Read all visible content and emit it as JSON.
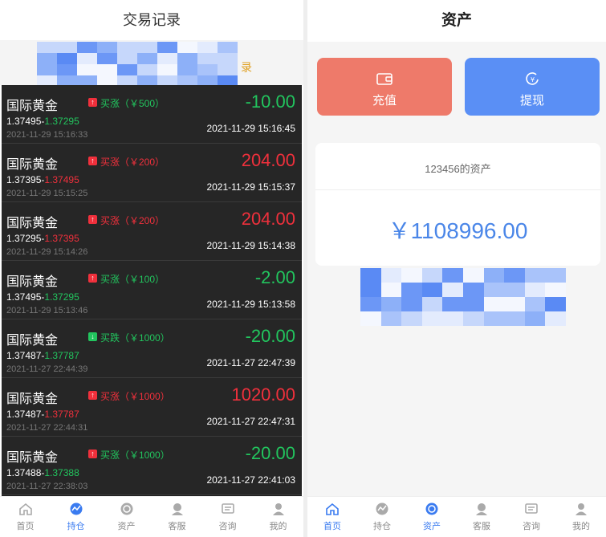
{
  "left": {
    "title": "交易记录",
    "subtab_right": "录",
    "trades": [
      {
        "name": "国际黄金",
        "direction": "up",
        "dir_label": "买涨（￥500）",
        "dir_color": "green",
        "profit": "-10.00",
        "profit_color": "green",
        "open_price": "1.37495-",
        "close_price": "1.37295",
        "close_color": "green",
        "open_time": "2021-11-29 15:16:33",
        "close_time": "2021-11-29 15:16:45"
      },
      {
        "name": "国际黄金",
        "direction": "up",
        "dir_label": "买涨（￥200）",
        "dir_color": "red",
        "profit": "204.00",
        "profit_color": "red",
        "open_price": "1.37395-",
        "close_price": "1.37495",
        "close_color": "red",
        "open_time": "2021-11-29 15:15:25",
        "close_time": "2021-11-29 15:15:37"
      },
      {
        "name": "国际黄金",
        "direction": "up",
        "dir_label": "买涨（￥200）",
        "dir_color": "red",
        "profit": "204.00",
        "profit_color": "red",
        "open_price": "1.37295-",
        "close_price": "1.37395",
        "close_color": "red",
        "open_time": "2021-11-29 15:14:26",
        "close_time": "2021-11-29 15:14:38"
      },
      {
        "name": "国际黄金",
        "direction": "up",
        "dir_label": "买涨（￥100）",
        "dir_color": "green",
        "profit": "-2.00",
        "profit_color": "green",
        "open_price": "1.37495-",
        "close_price": "1.37295",
        "close_color": "green",
        "open_time": "2021-11-29 15:13:46",
        "close_time": "2021-11-29 15:13:58"
      },
      {
        "name": "国际黄金",
        "direction": "down",
        "dir_label": "买跌（￥1000）",
        "dir_color": "green",
        "profit": "-20.00",
        "profit_color": "green",
        "open_price": "1.37487-",
        "close_price": "1.37787",
        "close_color": "green",
        "open_time": "2021-11-27 22:44:39",
        "close_time": "2021-11-27 22:47:39"
      },
      {
        "name": "国际黄金",
        "direction": "up",
        "dir_label": "买涨（￥1000）",
        "dir_color": "red",
        "profit": "1020.00",
        "profit_color": "red",
        "open_price": "1.37487-",
        "close_price": "1.37787",
        "close_color": "red",
        "open_time": "2021-11-27 22:44:31",
        "close_time": "2021-11-27 22:47:31"
      },
      {
        "name": "国际黄金",
        "direction": "up",
        "dir_label": "买涨（￥1000）",
        "dir_color": "green",
        "profit": "-20.00",
        "profit_color": "green",
        "open_price": "1.37488-",
        "close_price": "1.37388",
        "close_color": "green",
        "open_time": "2021-11-27 22:38:03",
        "close_time": "2021-11-27 22:41:03"
      }
    ],
    "nav": [
      {
        "label": "首页",
        "icon": "home-icon",
        "active": false
      },
      {
        "label": "持仓",
        "icon": "chart-icon",
        "active": true
      },
      {
        "label": "资产",
        "icon": "asset-icon",
        "active": false
      },
      {
        "label": "客服",
        "icon": "service-icon",
        "active": false
      },
      {
        "label": "咨询",
        "icon": "message-icon",
        "active": false
      },
      {
        "label": "我的",
        "icon": "user-icon",
        "active": false
      }
    ]
  },
  "right": {
    "title": "资产",
    "recharge_label": "充值",
    "withdraw_label": "提现",
    "owner": "123456的资产",
    "amount": "￥1108996.00",
    "nav": [
      {
        "label": "首页",
        "icon": "home-icon",
        "active": true
      },
      {
        "label": "持仓",
        "icon": "chart-icon",
        "active": false
      },
      {
        "label": "资产",
        "icon": "asset-icon",
        "active": true
      },
      {
        "label": "客服",
        "icon": "service-icon",
        "active": false
      },
      {
        "label": "咨询",
        "icon": "message-icon",
        "active": false
      },
      {
        "label": "我的",
        "icon": "user-icon",
        "active": false
      }
    ]
  },
  "colors": {
    "green": "#22c55e",
    "red": "#f0303c",
    "blue": "#4a86e8",
    "nav_active": "#3a7bf0"
  }
}
